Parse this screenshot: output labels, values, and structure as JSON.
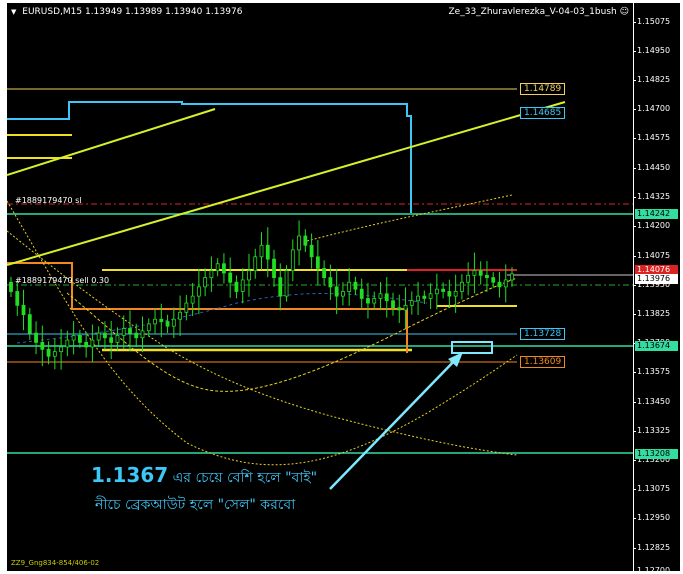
{
  "header": {
    "symbol_line": "EURUSD,M15  1.13949 1.13989 1.13940 1.13976",
    "indicator_name": "Ze_33_Zhuravlerezka_V-04-03_1bush"
  },
  "icons": {
    "menu": "triangle-down-icon",
    "indicator": "smiley-icon"
  },
  "price_axis": {
    "ticks": [
      "1.15075",
      "1.14950",
      "1.14825",
      "1.14700",
      "1.14575",
      "1.14450",
      "1.14325",
      "1.14200",
      "1.14075",
      "1.13950",
      "1.13825",
      "1.13700",
      "1.13575",
      "1.13450",
      "1.13325",
      "1.13200",
      "1.13075",
      "1.12950",
      "1.12825",
      "1.12700"
    ],
    "tags": [
      {
        "text": "1.14242",
        "bg": "#33dda0",
        "fg": "#000000"
      },
      {
        "text": "1.14076",
        "bg": "#dd2222",
        "fg": "#ffffff"
      },
      {
        "text": "1.13976",
        "bg": "#ffffff",
        "fg": "#000000"
      },
      {
        "text": "1.13674",
        "bg": "#33dda0",
        "fg": "#000000"
      },
      {
        "text": "1.13208",
        "bg": "#33dda0",
        "fg": "#000000"
      }
    ]
  },
  "levels": [
    {
      "text": "1.14789",
      "color": "#f0d060"
    },
    {
      "text": "1.14685",
      "color": "#3ec6f4"
    },
    {
      "text": "1.13728",
      "color": "#3ec6f4"
    },
    {
      "text": "1.13609",
      "color": "#f08a20"
    }
  ],
  "order_labels": {
    "sl": "#1889179470 sl",
    "sell": "#1889179470 sell 0.30"
  },
  "annotation": {
    "line1_big": "1.1367",
    "line1_rest": " এর চেয়ে বেশি হলে \"বাই\"",
    "line2": "নীচে ব্রেকআউট হলে \"সেল\" করবো"
  },
  "footer": "ZZ9_Gng834-854/406-02",
  "colors": {
    "background": "#000000",
    "candles": "#22dd22",
    "sr_lines": "#33dda0",
    "channel": "#d7f02a",
    "blue_line": "#3ec6f4",
    "orange_line": "#f08a20",
    "yellow_line": "#f0e020",
    "dotted_ma": "#e8d020",
    "sl_line": "#dd2222",
    "arrow": "#7de8ff"
  },
  "chart_data": {
    "type": "candlestick",
    "ylim": [
      1.127,
      1.151
    ],
    "close": [
      1.139,
      1.1384,
      1.138,
      1.1372,
      1.1368,
      1.1365,
      1.1362,
      1.1364,
      1.1366,
      1.1369,
      1.1371,
      1.1368,
      1.1366,
      1.1369,
      1.1372,
      1.137,
      1.1368,
      1.1371,
      1.1374,
      1.1372,
      1.137,
      1.1373,
      1.1376,
      1.1378,
      1.1377,
      1.1375,
      1.1378,
      1.1381,
      1.1385,
      1.1388,
      1.1392,
      1.1396,
      1.1399,
      1.1402,
      1.1398,
      1.1394,
      1.139,
      1.1395,
      1.1399,
      1.1405,
      1.141,
      1.1404,
      1.1396,
      1.1388,
      1.1399,
      1.1408,
      1.1414,
      1.141,
      1.1405,
      1.14,
      1.1396,
      1.1392,
      1.1388,
      1.139,
      1.1394,
      1.1391,
      1.1387,
      1.1385,
      1.1387,
      1.1389,
      1.1386,
      1.1383,
      1.1382,
      1.1384,
      1.1386,
      1.1388,
      1.1387,
      1.1389,
      1.1391,
      1.139,
      1.1388,
      1.139,
      1.1394,
      1.1397,
      1.1399,
      1.1397,
      1.1396,
      1.1394,
      1.1392,
      1.1395,
      1.13976
    ]
  }
}
